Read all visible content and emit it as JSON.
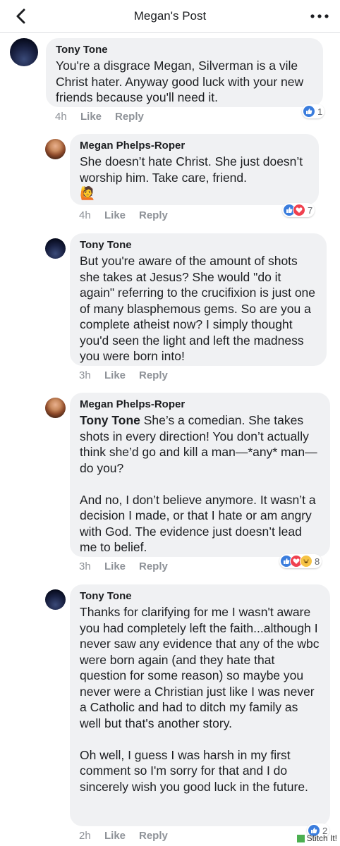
{
  "header": {
    "title": "Megan's Post"
  },
  "actions": {
    "like": "Like",
    "reply": "Reply"
  },
  "comments": [
    {
      "author": "Tony Tone",
      "text": "You're a disgrace Megan, Silverman is a vile Christ hater. Anyway good luck with your new friends because you'll need it.",
      "time": "4h",
      "reactions": {
        "types": [
          "like"
        ],
        "count": "1"
      }
    },
    {
      "author": "Megan Phelps-Roper",
      "text": "She doesn’t hate Christ. She just doesn’t worship him. Take care, friend.",
      "emoji": "🙋",
      "time": "4h",
      "reactions": {
        "types": [
          "like",
          "love"
        ],
        "count": "7"
      }
    },
    {
      "author": "Tony Tone",
      "text": "But you're aware of the amount of shots she takes at Jesus? She would \"do it again\" referring to the crucifixion is just one of many blasphemous gems. So are you a complete atheist now? I simply thought you'd seen the light and left the madness you were born into!",
      "time": "3h"
    },
    {
      "author": "Megan Phelps-Roper",
      "mention": "Tony Tone",
      "text": " She’s a comedian. She takes shots in every direction! You don’t actually think she’d go and kill a man—*any* man—do you?\n\nAnd no, I don’t believe anymore. It wasn’t a decision I made, or that I hate or am angry with God. The evidence just doesn’t lead me to belief.",
      "time": "3h",
      "reactions": {
        "types": [
          "like",
          "love",
          "haha"
        ],
        "count": "8"
      }
    },
    {
      "author": "Tony Tone",
      "text": "Thanks for clarifying for me I wasn't aware you had completely left the faith...although I never saw any evidence that any of the wbc were born again (and they hate that question for some reason) so maybe you never were a Christian just like I was never a Catholic and had to ditch my family as well but that's another story.\n\nOh well, I guess I was harsh in my first comment so I'm sorry for that and I do sincerely wish you good luck in the future.",
      "time": "2h",
      "reactions": {
        "types": [
          "like"
        ],
        "count": "2"
      }
    }
  ],
  "watermark": "Stitch It!",
  "colors": {
    "like": "#3b7ddd",
    "love": "#f0414f",
    "haha": "#f6c344",
    "bubble": "#f0f1f3"
  }
}
